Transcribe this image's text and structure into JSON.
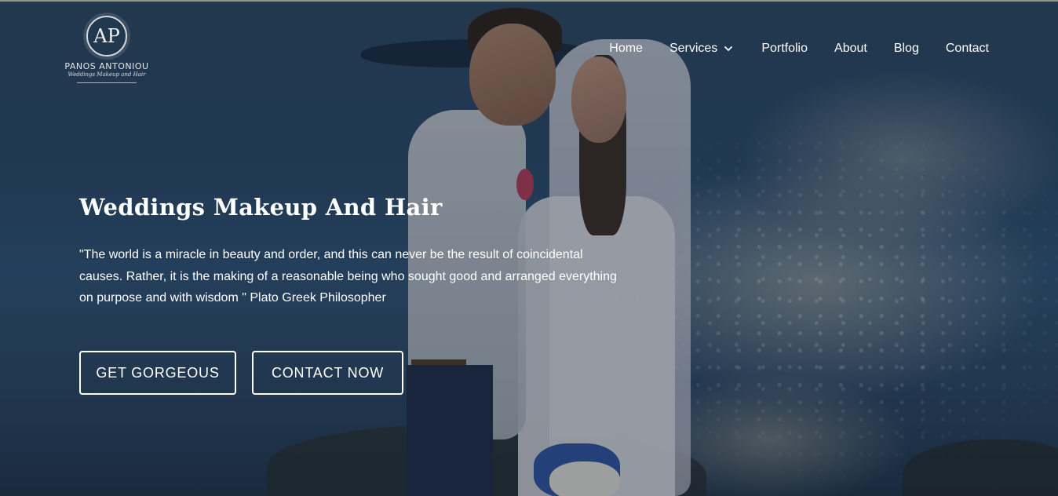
{
  "brand": {
    "monogram": "AP",
    "name": "PANOS ANTONIOU",
    "tagline": "Weddings Makeup and Hair"
  },
  "nav": {
    "items": [
      {
        "label": "Home"
      },
      {
        "label": "Services",
        "has_dropdown": true,
        "icon": "chevron-down-icon"
      },
      {
        "label": "Portfolio"
      },
      {
        "label": "About"
      },
      {
        "label": "Blog"
      },
      {
        "label": "Contact"
      }
    ]
  },
  "hero": {
    "title": "Weddings Makeup And Hair",
    "quote": "\"The world is a miracle in beauty and order, and this can never be the result of coincidental causes. Rather, it is the making of a reasonable being who sought good and arranged everything on purpose and with wisdom \" Plato Greek Philosopher",
    "buttons": {
      "primary": "GET GORGEOUS",
      "secondary": "CONTACT NOW"
    }
  },
  "colors": {
    "text": "#ffffff",
    "overlay": "#121c2a",
    "sea": "#2b4a66"
  }
}
